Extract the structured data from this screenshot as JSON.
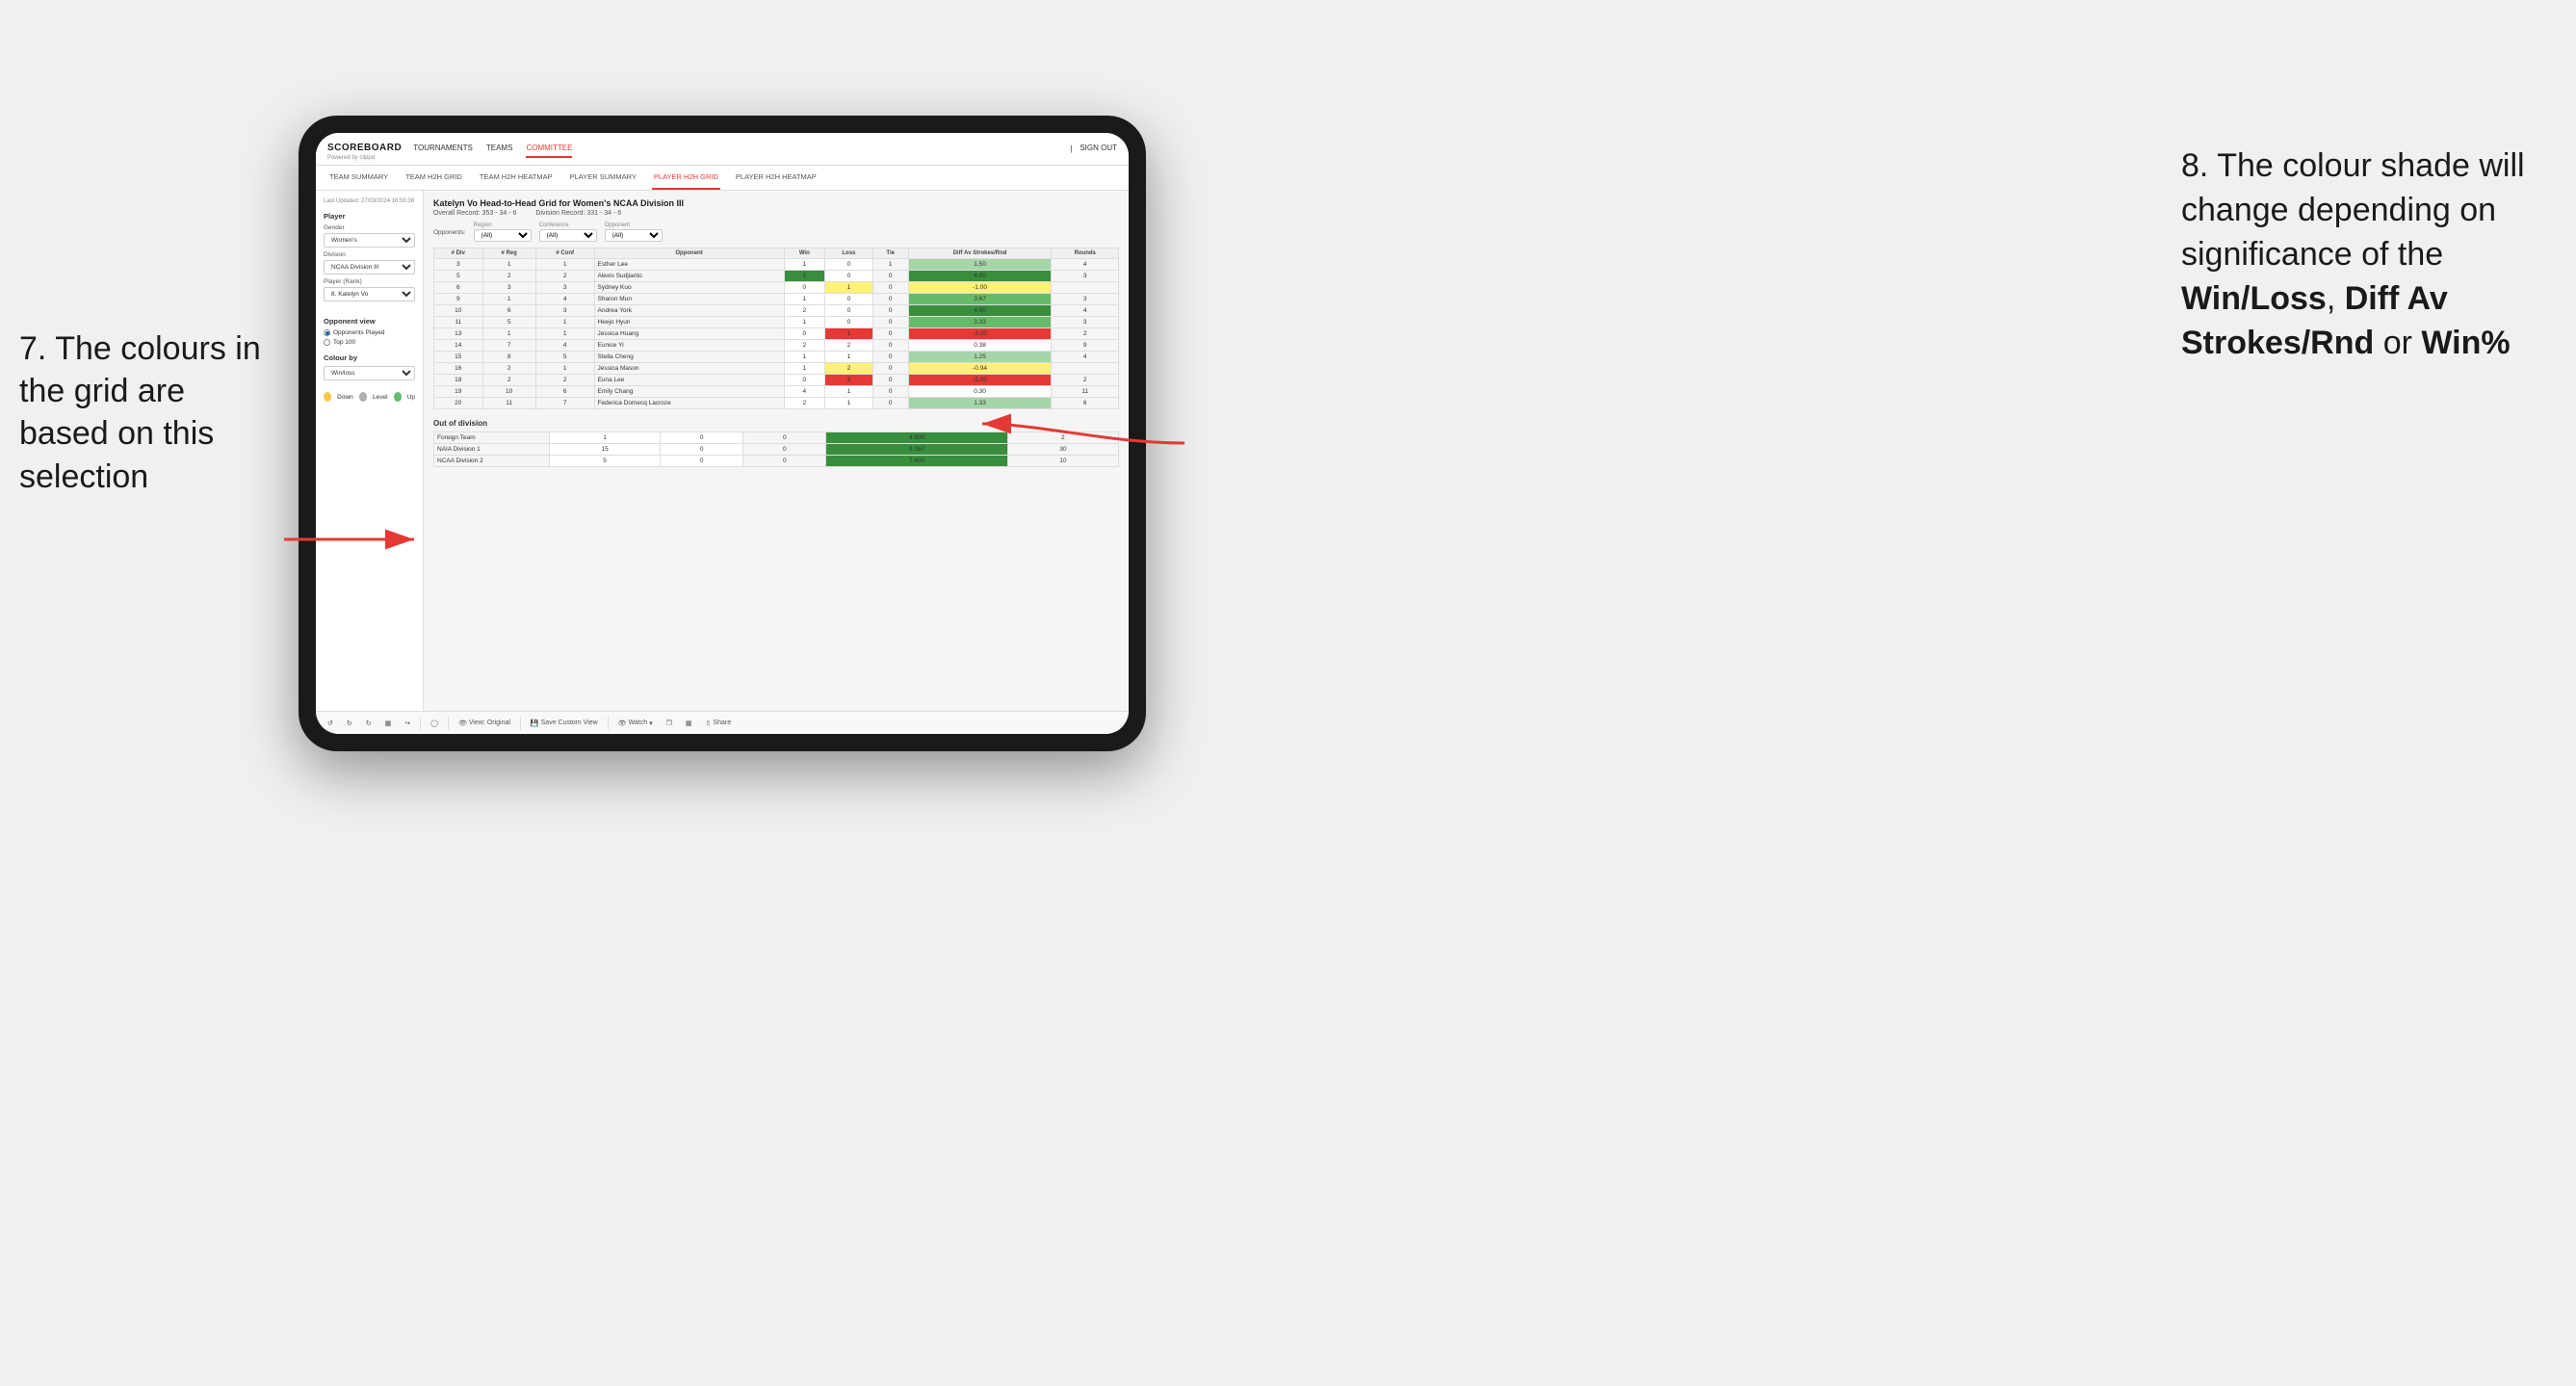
{
  "app": {
    "logo": "SCOREBOARD",
    "logo_sub": "Powered by clippd",
    "sign_in": "Sign out"
  },
  "nav": {
    "items": [
      {
        "label": "TOURNAMENTS",
        "active": false
      },
      {
        "label": "TEAMS",
        "active": false
      },
      {
        "label": "COMMITTEE",
        "active": true
      }
    ]
  },
  "sub_nav": {
    "items": [
      {
        "label": "TEAM SUMMARY",
        "active": false
      },
      {
        "label": "TEAM H2H GRID",
        "active": false
      },
      {
        "label": "TEAM H2H HEATMAP",
        "active": false
      },
      {
        "label": "PLAYER SUMMARY",
        "active": false
      },
      {
        "label": "PLAYER H2H GRID",
        "active": true
      },
      {
        "label": "PLAYER H2H HEATMAP",
        "active": false
      }
    ]
  },
  "sidebar": {
    "timestamp": "Last Updated: 27/03/2024 16:55:38",
    "player_section": "Player",
    "gender_label": "Gender",
    "gender_value": "Women's",
    "division_label": "Division",
    "division_value": "NCAA Division III",
    "player_rank_label": "Player (Rank)",
    "player_rank_value": "8. Katelyn Vo",
    "opponent_view_title": "Opponent view",
    "radio_options": [
      {
        "label": "Opponents Played",
        "selected": true
      },
      {
        "label": "Top 100",
        "selected": false
      }
    ],
    "colour_by_title": "Colour by",
    "colour_by_value": "Win/loss",
    "legend": [
      {
        "color": "#f9c84a",
        "label": "Down"
      },
      {
        "color": "#b0b0b0",
        "label": "Level"
      },
      {
        "color": "#66bb6a",
        "label": "Up"
      }
    ]
  },
  "grid": {
    "title": "Katelyn Vo Head-to-Head Grid for Women's NCAA Division III",
    "overall_record_label": "Overall Record:",
    "overall_record": "353 - 34 - 6",
    "division_record_label": "Division Record:",
    "division_record": "331 - 34 - 6",
    "filter_region_label": "Region",
    "filter_region_value": "(All)",
    "filter_conference_label": "Conference",
    "filter_conference_value": "(All)",
    "filter_opponent_label": "Opponent",
    "filter_opponent_value": "(All)",
    "opponents_label": "Opponents:",
    "columns": [
      "# Div",
      "# Reg",
      "# Conf",
      "Opponent",
      "Win",
      "Loss",
      "Tie",
      "Diff Av Strokes/Rnd",
      "Rounds"
    ],
    "rows": [
      {
        "div": 3,
        "reg": 1,
        "conf": 1,
        "opponent": "Esther Lee",
        "win": 1,
        "loss": 0,
        "tie": 1,
        "diff": 1.5,
        "rounds": 4,
        "win_color": "white",
        "loss_color": "white",
        "diff_color": "green-light"
      },
      {
        "div": 5,
        "reg": 2,
        "conf": 2,
        "opponent": "Alexis Sudjianto",
        "win": 1,
        "loss": 0,
        "tie": 0,
        "diff": 4.0,
        "rounds": 3,
        "win_color": "white",
        "loss_color": "white",
        "diff_color": "green-dark"
      },
      {
        "div": 6,
        "reg": 3,
        "conf": 3,
        "opponent": "Sydney Kuo",
        "win": 0,
        "loss": 1,
        "tie": 0,
        "diff": -1.0,
        "rounds": "",
        "win_color": "white",
        "loss_color": "yellow",
        "diff_color": "yellow"
      },
      {
        "div": 9,
        "reg": 1,
        "conf": 4,
        "opponent": "Sharon Mun",
        "win": 1,
        "loss": 0,
        "tie": 0,
        "diff": 3.67,
        "rounds": 3,
        "win_color": "white",
        "loss_color": "white",
        "diff_color": "green-mid"
      },
      {
        "div": 10,
        "reg": 6,
        "conf": 3,
        "opponent": "Andrea York",
        "win": 2,
        "loss": 0,
        "tie": 0,
        "diff": 4.0,
        "rounds": 4,
        "win_color": "white",
        "loss_color": "white",
        "diff_color": "green-dark"
      },
      {
        "div": 11,
        "reg": 5,
        "conf": 1,
        "opponent": "Heejo Hyun",
        "win": 1,
        "loss": 0,
        "tie": 0,
        "diff": 3.33,
        "rounds": 3,
        "win_color": "white",
        "loss_color": "white",
        "diff_color": "green-mid"
      },
      {
        "div": 13,
        "reg": 1,
        "conf": 1,
        "opponent": "Jessica Huang",
        "win": 0,
        "loss": 1,
        "tie": 0,
        "diff": -3.0,
        "rounds": 2,
        "win_color": "white",
        "loss_color": "red-mid",
        "diff_color": "red-mid"
      },
      {
        "div": 14,
        "reg": 7,
        "conf": 4,
        "opponent": "Eunice Yi",
        "win": 2,
        "loss": 2,
        "tie": 0,
        "diff": 0.38,
        "rounds": 9,
        "win_color": "white",
        "loss_color": "white",
        "diff_color": "white"
      },
      {
        "div": 15,
        "reg": 8,
        "conf": 5,
        "opponent": "Stella Cheng",
        "win": 1,
        "loss": 1,
        "tie": 0,
        "diff": 1.25,
        "rounds": 4,
        "win_color": "white",
        "loss_color": "white",
        "diff_color": "green-light"
      },
      {
        "div": 16,
        "reg": 2,
        "conf": 1,
        "opponent": "Jessica Mason",
        "win": 1,
        "loss": 2,
        "tie": 0,
        "diff": -0.94,
        "rounds": "",
        "win_color": "white",
        "loss_color": "yellow",
        "diff_color": "yellow"
      },
      {
        "div": 18,
        "reg": 2,
        "conf": 2,
        "opponent": "Euna Lee",
        "win": 0,
        "loss": 3,
        "tie": 0,
        "diff": -5.0,
        "rounds": 2,
        "win_color": "white",
        "loss_color": "red-mid",
        "diff_color": "red-mid"
      },
      {
        "div": 19,
        "reg": 10,
        "conf": 6,
        "opponent": "Emily Chang",
        "win": 4,
        "loss": 1,
        "tie": 0,
        "diff": 0.3,
        "rounds": 11,
        "win_color": "white",
        "loss_color": "white",
        "diff_color": "white"
      },
      {
        "div": 20,
        "reg": 11,
        "conf": 7,
        "opponent": "Federica Domecq Lacroze",
        "win": 2,
        "loss": 1,
        "tie": 0,
        "diff": 1.33,
        "rounds": 6,
        "win_color": "white",
        "loss_color": "white",
        "diff_color": "green-light"
      }
    ],
    "out_of_division_title": "Out of division",
    "out_of_division_rows": [
      {
        "opponent": "Foreign Team",
        "win": 1,
        "loss": 0,
        "tie": 0,
        "diff": 4.5,
        "rounds": 2,
        "win_color": "white",
        "diff_color": "green-dark"
      },
      {
        "opponent": "NAIA Division 1",
        "win": 15,
        "loss": 0,
        "tie": 0,
        "diff": 9.267,
        "rounds": 30,
        "win_color": "white",
        "diff_color": "green-dark"
      },
      {
        "opponent": "NCAA Division 2",
        "win": 5,
        "loss": 0,
        "tie": 0,
        "diff": 7.4,
        "rounds": 10,
        "win_color": "white",
        "diff_color": "green-dark"
      }
    ]
  },
  "toolbar": {
    "view_original": "View: Original",
    "save_custom": "Save Custom View",
    "watch": "Watch",
    "share": "Share"
  },
  "annotations": {
    "left_text": "7. The colours in the grid are based on this selection",
    "right_title": "8. The colour shade will change depending on significance of the ",
    "right_bold1": "Win/Loss",
    "right_sep1": ", ",
    "right_bold2": "Diff Av Strokes/Rnd",
    "right_sep2": " or ",
    "right_bold3": "Win%"
  }
}
